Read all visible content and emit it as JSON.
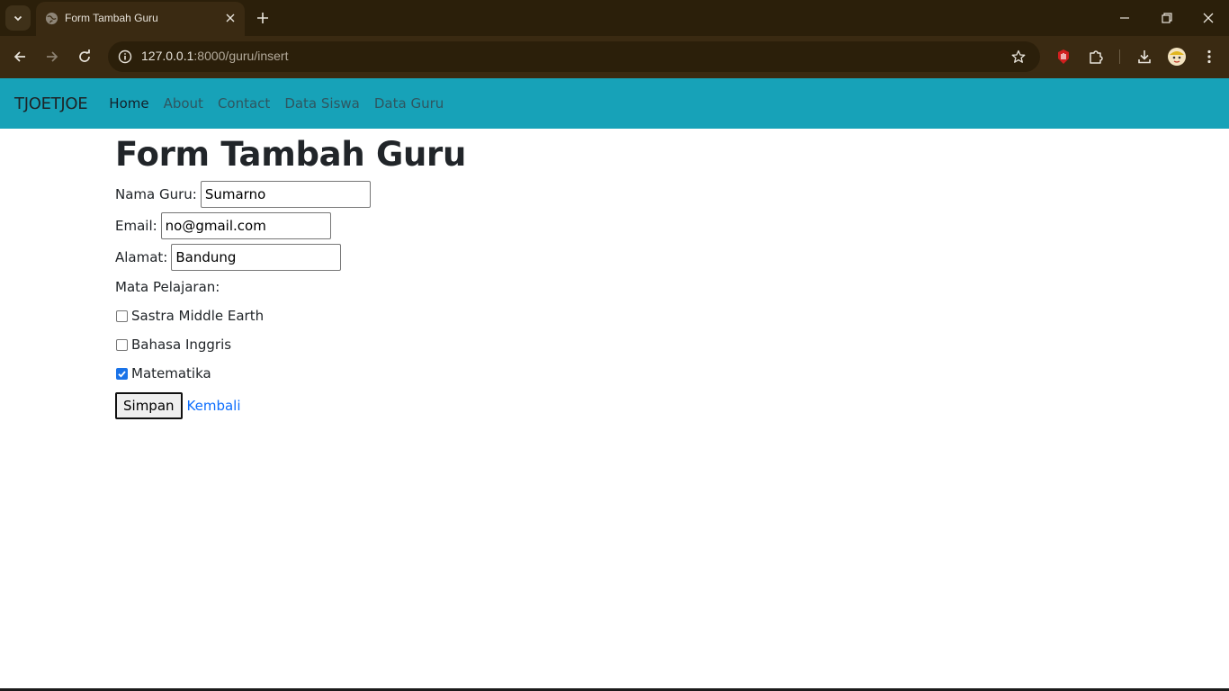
{
  "browser": {
    "tab": {
      "title": "Form Tambah Guru",
      "favicon": "globe-icon"
    },
    "url": {
      "host": "127.0.0.1",
      "rest": ":8000/guru/insert"
    },
    "colors": {
      "frame": "#2b1f0a",
      "toolbar": "#3a2a12"
    }
  },
  "navbar": {
    "brand": "TJOETJOE",
    "color": "#17a2b8",
    "links": [
      {
        "label": "Home",
        "active": true
      },
      {
        "label": "About"
      },
      {
        "label": "Contact"
      },
      {
        "label": "Data Siswa"
      },
      {
        "label": "Data Guru"
      }
    ]
  },
  "form": {
    "title": "Form Tambah Guru",
    "nama": {
      "label": "Nama Guru:",
      "value": "Sumarno"
    },
    "email": {
      "label": "Email:",
      "value": "no@gmail.com"
    },
    "alamat": {
      "label": "Alamat:",
      "value": "Bandung"
    },
    "mapel_label": "Mata Pelajaran:",
    "mapel": [
      {
        "label": "Sastra Middle Earth",
        "checked": false
      },
      {
        "label": "Bahasa Inggris",
        "checked": false
      },
      {
        "label": "Matematika",
        "checked": true
      }
    ],
    "submit_label": "Simpan",
    "back_label": "Kembali"
  }
}
